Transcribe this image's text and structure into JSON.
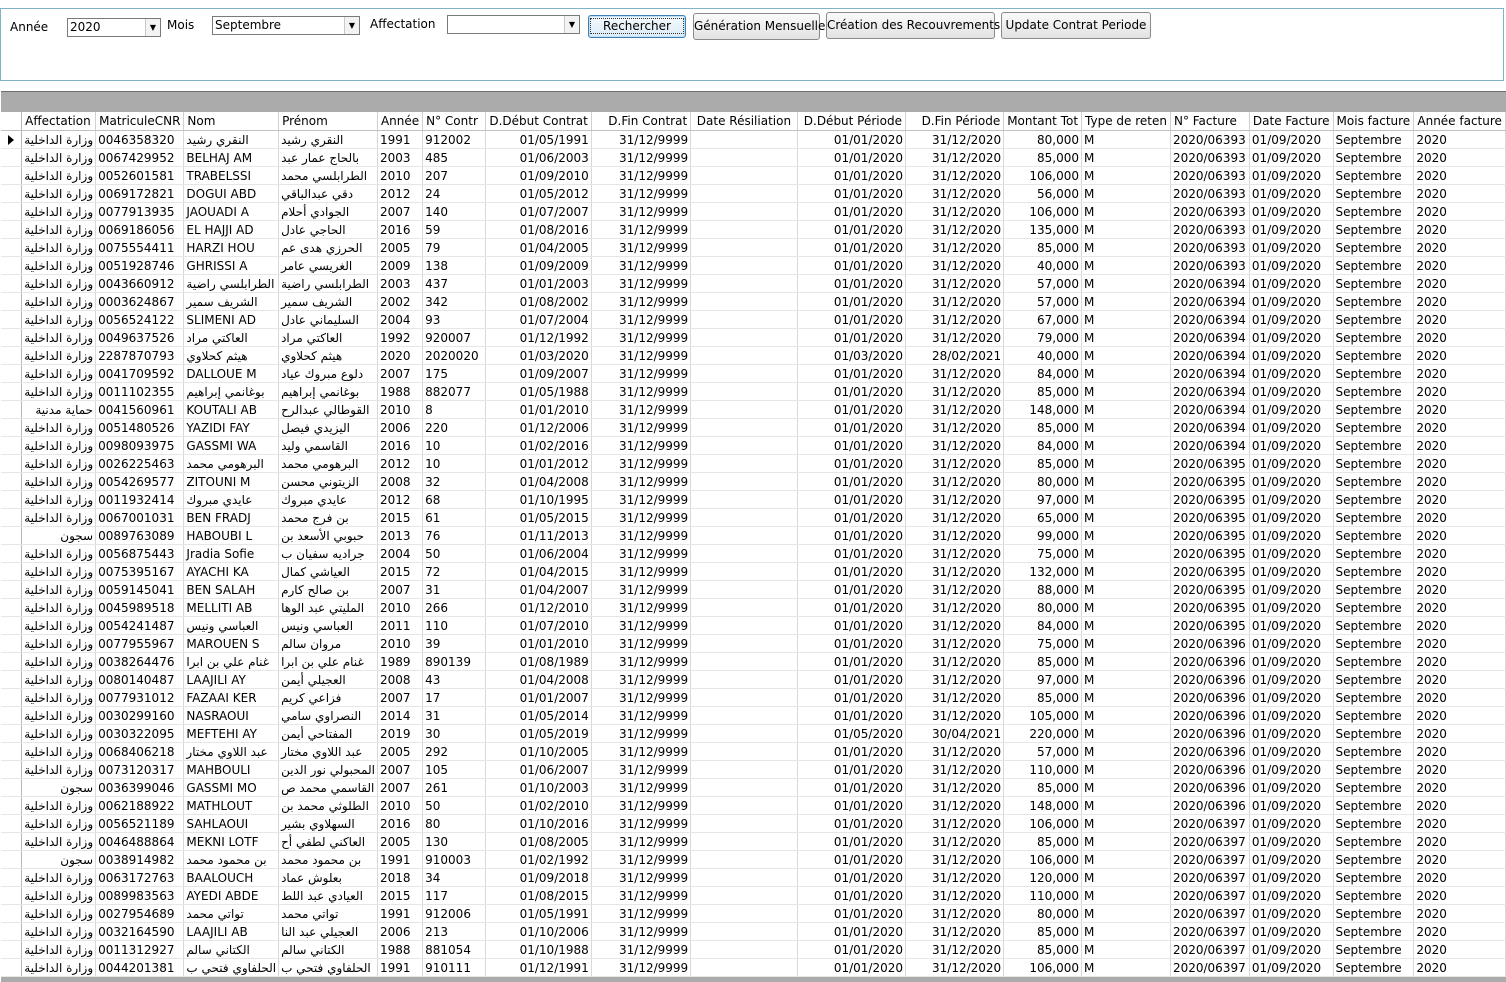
{
  "filters": {
    "annee_label": "Année",
    "annee_value": "2020",
    "mois_label": "Mois",
    "mois_value": "Septembre",
    "affectation_label": "Affectation",
    "affectation_value": ""
  },
  "buttons": {
    "rechercher": "Rechercher",
    "generation": "Génération Mensuelle",
    "creation": "Création des Recouvrements",
    "update": "Update Contrat Periode"
  },
  "grid": {
    "columns": [
      "Affectation",
      "MatriculeCNR",
      "Nom",
      "Prénom",
      "Année",
      "N° Contr",
      "D.Début Contrat",
      "D.Fin Contrat",
      "Date Résiliation",
      "D.Début Période",
      "D.Fin Période",
      "Montant Tot",
      "Type de reten",
      "N° Facture",
      "Date Facture",
      "Mois facture",
      "Année facture"
    ],
    "rows": [
      [
        "وزارة الداخلية",
        "0046358320",
        "النقري رشيد",
        "النقري رشيد",
        "1991",
        "912002",
        "01/05/1991",
        "31/12/9999",
        "",
        "01/01/2020",
        "31/12/2020",
        "80,000",
        "M",
        "2020/06393",
        "01/09/2020",
        "Septembre",
        "2020"
      ],
      [
        "وزارة الداخلية",
        "0067429952",
        "BELHAJ AM",
        "بالحاج عمار عبد",
        "2003",
        "485",
        "01/06/2003",
        "31/12/9999",
        "",
        "01/01/2020",
        "31/12/2020",
        "85,000",
        "M",
        "2020/06393",
        "01/09/2020",
        "Septembre",
        "2020"
      ],
      [
        "وزارة الداخلية",
        "0052601581",
        "TRABELSSI",
        "الطرابلسي محمد",
        "2010",
        "207",
        "01/09/2010",
        "31/12/9999",
        "",
        "01/01/2020",
        "31/12/2020",
        "106,000",
        "M",
        "2020/06393",
        "01/09/2020",
        "Septembre",
        "2020"
      ],
      [
        "وزارة الداخلية",
        "0069172821",
        "DOGUI ABD",
        "دقي عبدالباقي",
        "2012",
        "24",
        "01/05/2012",
        "31/12/9999",
        "",
        "01/01/2020",
        "31/12/2020",
        "56,000",
        "M",
        "2020/06393",
        "01/09/2020",
        "Septembre",
        "2020"
      ],
      [
        "وزارة الداخلية",
        "0077913935",
        "JAOUADI A",
        "الجوادي أحلام",
        "2007",
        "140",
        "01/07/2007",
        "31/12/9999",
        "",
        "01/01/2020",
        "31/12/2020",
        "106,000",
        "M",
        "2020/06393",
        "01/09/2020",
        "Septembre",
        "2020"
      ],
      [
        "وزارة الداخلية",
        "0069186056",
        "EL HAJJI AD",
        "الحاجي عادل",
        "2016",
        "59",
        "01/08/2016",
        "31/12/9999",
        "",
        "01/01/2020",
        "31/12/2020",
        "135,000",
        "M",
        "2020/06393",
        "01/09/2020",
        "Septembre",
        "2020"
      ],
      [
        "وزارة الداخلية",
        "0075554411",
        "HARZI HOU",
        "الحرزي هدى عم",
        "2005",
        "79",
        "01/04/2005",
        "31/12/9999",
        "",
        "01/01/2020",
        "31/12/2020",
        "85,000",
        "M",
        "2020/06393",
        "01/09/2020",
        "Septembre",
        "2020"
      ],
      [
        "وزارة الداخلية",
        "0051928746",
        "GHRISSI A",
        "الغريسي عامر",
        "2009",
        "138",
        "01/09/2009",
        "31/12/9999",
        "",
        "01/01/2020",
        "31/12/2020",
        "40,000",
        "M",
        "2020/06393",
        "01/09/2020",
        "Septembre",
        "2020"
      ],
      [
        "وزارة الداخلية",
        "0043660912",
        "الطرابلسي راضية",
        "الطرابلسي راضية",
        "2003",
        "437",
        "01/01/2003",
        "31/12/9999",
        "",
        "01/01/2020",
        "31/12/2020",
        "57,000",
        "M",
        "2020/06394",
        "01/09/2020",
        "Septembre",
        "2020"
      ],
      [
        "وزارة الداخلية",
        "0003624867",
        "الشريف سمير",
        "الشريف سمير",
        "2002",
        "342",
        "01/08/2002",
        "31/12/9999",
        "",
        "01/01/2020",
        "31/12/2020",
        "57,000",
        "M",
        "2020/06394",
        "01/09/2020",
        "Septembre",
        "2020"
      ],
      [
        "وزارة الداخلية",
        "0056524122",
        "SLIMENI AD",
        "السليماني عادل",
        "2004",
        "93",
        "01/07/2004",
        "31/12/9999",
        "",
        "01/01/2020",
        "31/12/2020",
        "67,000",
        "M",
        "2020/06394",
        "01/09/2020",
        "Septembre",
        "2020"
      ],
      [
        "وزارة الداخلية",
        "0049637526",
        "العاكتي مراد",
        "العاكتي مراد",
        "1992",
        "920007",
        "01/12/1992",
        "31/12/9999",
        "",
        "01/01/2020",
        "31/12/2020",
        "79,000",
        "M",
        "2020/06394",
        "01/09/2020",
        "Septembre",
        "2020"
      ],
      [
        "وزارة الداخلية",
        "2287870793",
        "هيثم كحلاوي",
        "هيثم كحلاوي",
        "2020",
        "2020020",
        "01/03/2020",
        "31/12/9999",
        "",
        "01/03/2020",
        "28/02/2021",
        "40,000",
        "M",
        "2020/06394",
        "01/09/2020",
        "Septembre",
        "2020"
      ],
      [
        "وزارة الداخلية",
        "0041709592",
        "DALLOUE M",
        "دلوع مبروك عياد",
        "2007",
        "175",
        "01/09/2007",
        "31/12/9999",
        "",
        "01/01/2020",
        "31/12/2020",
        "84,000",
        "M",
        "2020/06394",
        "01/09/2020",
        "Septembre",
        "2020"
      ],
      [
        "وزارة الداخلية",
        "0011102355",
        "بوغانمي إبراهيم",
        "بوغانمي إبراهيم",
        "1988",
        "882077",
        "01/05/1988",
        "31/12/9999",
        "",
        "01/01/2020",
        "31/12/2020",
        "85,000",
        "M",
        "2020/06394",
        "01/09/2020",
        "Septembre",
        "2020"
      ],
      [
        "حماية مدنية",
        "0041560961",
        "KOUTALI AB",
        "القوطالي عبدالرح",
        "2010",
        "8",
        "01/01/2010",
        "31/12/9999",
        "",
        "01/01/2020",
        "31/12/2020",
        "148,000",
        "M",
        "2020/06394",
        "01/09/2020",
        "Septembre",
        "2020"
      ],
      [
        "وزارة الداخلية",
        "0051480526",
        "YAZIDI FAY",
        "اليزيدي فيصل",
        "2006",
        "220",
        "01/12/2006",
        "31/12/9999",
        "",
        "01/01/2020",
        "31/12/2020",
        "85,000",
        "M",
        "2020/06394",
        "01/09/2020",
        "Septembre",
        "2020"
      ],
      [
        "وزارة الداخلية",
        "0098093975",
        "GASSMI WA",
        "القاسمي وليد",
        "2016",
        "10",
        "01/02/2016",
        "31/12/9999",
        "",
        "01/01/2020",
        "31/12/2020",
        "84,000",
        "M",
        "2020/06394",
        "01/09/2020",
        "Septembre",
        "2020"
      ],
      [
        "وزارة الداخلية",
        "0026225463",
        "البرهومي محمد",
        "البرهومي محمد",
        "2012",
        "10",
        "01/01/2012",
        "31/12/9999",
        "",
        "01/01/2020",
        "31/12/2020",
        "85,000",
        "M",
        "2020/06395",
        "01/09/2020",
        "Septembre",
        "2020"
      ],
      [
        "وزارة الداخلية",
        "0054269577",
        "ZITOUNI M",
        "الزيتوني محسن",
        "2008",
        "32",
        "01/04/2008",
        "31/12/9999",
        "",
        "01/01/2020",
        "31/12/2020",
        "80,000",
        "M",
        "2020/06395",
        "01/09/2020",
        "Septembre",
        "2020"
      ],
      [
        "وزارة الداخلية",
        "0011932414",
        "عايدي مبروك",
        "عايدي مبروك",
        "2012",
        "68",
        "01/10/1995",
        "31/12/9999",
        "",
        "01/01/2020",
        "31/12/2020",
        "97,000",
        "M",
        "2020/06395",
        "01/09/2020",
        "Septembre",
        "2020"
      ],
      [
        "وزارة الداخلية",
        "0067001031",
        "BEN FRADJ",
        "بن فرج محمد",
        "2015",
        "61",
        "01/05/2015",
        "31/12/9999",
        "",
        "01/01/2020",
        "31/12/2020",
        "65,000",
        "M",
        "2020/06395",
        "01/09/2020",
        "Septembre",
        "2020"
      ],
      [
        "سجون",
        "0089763089",
        "HABOUBI L",
        "حبوبي الأسعد بن",
        "2013",
        "76",
        "01/11/2013",
        "31/12/9999",
        "",
        "01/01/2020",
        "31/12/2020",
        "99,000",
        "M",
        "2020/06395",
        "01/09/2020",
        "Septembre",
        "2020"
      ],
      [
        "وزارة الداخلية",
        "0056875443",
        "Jradia Sofie",
        "جراديه سفيان ب",
        "2004",
        "50",
        "01/06/2004",
        "31/12/9999",
        "",
        "01/01/2020",
        "31/12/2020",
        "75,000",
        "M",
        "2020/06395",
        "01/09/2020",
        "Septembre",
        "2020"
      ],
      [
        "وزارة الداخلية",
        "0075395167",
        "AYACHI KA",
        "العياشي كمال",
        "2015",
        "72",
        "01/04/2015",
        "31/12/9999",
        "",
        "01/01/2020",
        "31/12/2020",
        "132,000",
        "M",
        "2020/06395",
        "01/09/2020",
        "Septembre",
        "2020"
      ],
      [
        "وزارة الداخلية",
        "0059145041",
        "BEN SALAH",
        "بن صالح كارم",
        "2007",
        "31",
        "01/04/2007",
        "31/12/9999",
        "",
        "01/01/2020",
        "31/12/2020",
        "88,000",
        "M",
        "2020/06395",
        "01/09/2020",
        "Septembre",
        "2020"
      ],
      [
        "وزارة الداخلية",
        "0045989518",
        "MELLITI AB",
        "المليتي عبد الوها",
        "2010",
        "266",
        "01/12/2010",
        "31/12/9999",
        "",
        "01/01/2020",
        "31/12/2020",
        "80,000",
        "M",
        "2020/06395",
        "01/09/2020",
        "Septembre",
        "2020"
      ],
      [
        "وزارة الداخلية",
        "0054241487",
        "العباسي ونيس",
        "العباسي ونيس",
        "2011",
        "110",
        "01/07/2010",
        "31/12/9999",
        "",
        "01/01/2020",
        "31/12/2020",
        "84,000",
        "M",
        "2020/06395",
        "01/09/2020",
        "Septembre",
        "2020"
      ],
      [
        "وزارة الداخلية",
        "0077955967",
        "MAROUEN S",
        "مروان سالم",
        "2010",
        "39",
        "01/01/2010",
        "31/12/9999",
        "",
        "01/01/2020",
        "31/12/2020",
        "75,000",
        "M",
        "2020/06396",
        "01/09/2020",
        "Septembre",
        "2020"
      ],
      [
        "وزارة الداخلية",
        "0038264476",
        "غنام علي بن ابرا",
        "غنام علي بن ابرا",
        "1989",
        "890139",
        "01/08/1989",
        "31/12/9999",
        "",
        "01/01/2020",
        "31/12/2020",
        "85,000",
        "M",
        "2020/06396",
        "01/09/2020",
        "Septembre",
        "2020"
      ],
      [
        "وزارة الداخلية",
        "0080140487",
        "LAAJILI AY",
        "العجيلي أيمن",
        "2008",
        "43",
        "01/04/2008",
        "31/12/9999",
        "",
        "01/01/2020",
        "31/12/2020",
        "97,000",
        "M",
        "2020/06396",
        "01/09/2020",
        "Septembre",
        "2020"
      ],
      [
        "وزارة الداخلية",
        "0077931012",
        "FAZAAI KER",
        "فزاعي كريم",
        "2007",
        "17",
        "01/01/2007",
        "31/12/9999",
        "",
        "01/01/2020",
        "31/12/2020",
        "85,000",
        "M",
        "2020/06396",
        "01/09/2020",
        "Septembre",
        "2020"
      ],
      [
        "وزارة الداخلية",
        "0030299160",
        "NASRAOUI",
        "النصراوي سامي",
        "2014",
        "31",
        "01/05/2014",
        "31/12/9999",
        "",
        "01/01/2020",
        "31/12/2020",
        "105,000",
        "M",
        "2020/06396",
        "01/09/2020",
        "Septembre",
        "2020"
      ],
      [
        "وزارة الداخلية",
        "0030322095",
        "MEFTEHI AY",
        "المفتاحي أيمن",
        "2019",
        "30",
        "01/05/2019",
        "31/12/9999",
        "",
        "01/05/2020",
        "30/04/2021",
        "220,000",
        "M",
        "2020/06396",
        "01/09/2020",
        "Septembre",
        "2020"
      ],
      [
        "وزارة الداخلية",
        "0068406218",
        "عبد اللاوي مختار",
        "عبد اللاوي مختار",
        "2005",
        "292",
        "01/10/2005",
        "31/12/9999",
        "",
        "01/01/2020",
        "31/12/2020",
        "57,000",
        "M",
        "2020/06396",
        "01/09/2020",
        "Septembre",
        "2020"
      ],
      [
        "وزارة الداخلية",
        "0073120317",
        "MAHBOULI",
        "المحبولي نور الدين",
        "2007",
        "105",
        "01/06/2007",
        "31/12/9999",
        "",
        "01/01/2020",
        "31/12/2020",
        "110,000",
        "M",
        "2020/06396",
        "01/09/2020",
        "Septembre",
        "2020"
      ],
      [
        "سجون",
        "0036399046",
        "GASSMI MO",
        "القاسمي محمد ص",
        "2007",
        "261",
        "01/10/2003",
        "31/12/9999",
        "",
        "01/01/2020",
        "31/12/2020",
        "85,000",
        "M",
        "2020/06396",
        "01/09/2020",
        "Septembre",
        "2020"
      ],
      [
        "وزارة الداخلية",
        "0062188922",
        "MATHLOUT",
        "الطلوثي محمد بن",
        "2010",
        "50",
        "01/02/2010",
        "31/12/9999",
        "",
        "01/01/2020",
        "31/12/2020",
        "148,000",
        "M",
        "2020/06396",
        "01/09/2020",
        "Septembre",
        "2020"
      ],
      [
        "وزارة الداخلية",
        "0056521189",
        "SAHLAOUI",
        "السهلاوي بشير",
        "2016",
        "80",
        "01/10/2016",
        "31/12/9999",
        "",
        "01/01/2020",
        "31/12/2020",
        "106,000",
        "M",
        "2020/06397",
        "01/09/2020",
        "Septembre",
        "2020"
      ],
      [
        "وزارة الداخلية",
        "0046488864",
        "MEKNI LOTF",
        "العاكني لطفي أح",
        "2005",
        "130",
        "01/08/2005",
        "31/12/9999",
        "",
        "01/01/2020",
        "31/12/2020",
        "85,000",
        "M",
        "2020/06397",
        "01/09/2020",
        "Septembre",
        "2020"
      ],
      [
        "سجون",
        "0038914982",
        "بن محمود محمد",
        "بن محمود محمد",
        "1991",
        "910003",
        "01/02/1992",
        "31/12/9999",
        "",
        "01/01/2020",
        "31/12/2020",
        "106,000",
        "M",
        "2020/06397",
        "01/09/2020",
        "Septembre",
        "2020"
      ],
      [
        "وزارة الداخلية",
        "0063172763",
        "BAALOUCH",
        "بعلوش عماد",
        "2018",
        "34",
        "01/09/2018",
        "31/12/9999",
        "",
        "01/01/2020",
        "31/12/2020",
        "120,000",
        "M",
        "2020/06397",
        "01/09/2020",
        "Septembre",
        "2020"
      ],
      [
        "وزارة الداخلية",
        "0089983563",
        "AYEDI ABDE",
        "العيادي عبد اللط",
        "2015",
        "117",
        "01/08/2015",
        "31/12/9999",
        "",
        "01/01/2020",
        "31/12/2020",
        "110,000",
        "M",
        "2020/06397",
        "01/09/2020",
        "Septembre",
        "2020"
      ],
      [
        "وزارة الداخلية",
        "0027954689",
        "تواتي محمد",
        "تواتي محمد",
        "1991",
        "912006",
        "01/05/1991",
        "31/12/9999",
        "",
        "01/01/2020",
        "31/12/2020",
        "80,000",
        "M",
        "2020/06397",
        "01/09/2020",
        "Septembre",
        "2020"
      ],
      [
        "وزارة الداخلية",
        "0032164590",
        "LAAJILI AB",
        "العجيلي عبد النا",
        "2006",
        "213",
        "01/10/2006",
        "31/12/9999",
        "",
        "01/01/2020",
        "31/12/2020",
        "85,000",
        "M",
        "2020/06397",
        "01/09/2020",
        "Septembre",
        "2020"
      ],
      [
        "وزارة الداخلية",
        "0011312927",
        "الكتاني سالم",
        "الكتاني سالم",
        "1988",
        "881054",
        "01/10/1988",
        "31/12/9999",
        "",
        "01/01/2020",
        "31/12/2020",
        "85,000",
        "M",
        "2020/06397",
        "01/09/2020",
        "Septembre",
        "2020"
      ],
      [
        "وزارة الداخلية",
        "0044201381",
        "الحلفاوي فتحي ب",
        "الحلفاوي فتحي ب",
        "1991",
        "910111",
        "01/12/1991",
        "31/12/9999",
        "",
        "01/01/2020",
        "31/12/2020",
        "106,000",
        "M",
        "2020/06397",
        "01/09/2020",
        "Septembre",
        "2020"
      ]
    ]
  }
}
